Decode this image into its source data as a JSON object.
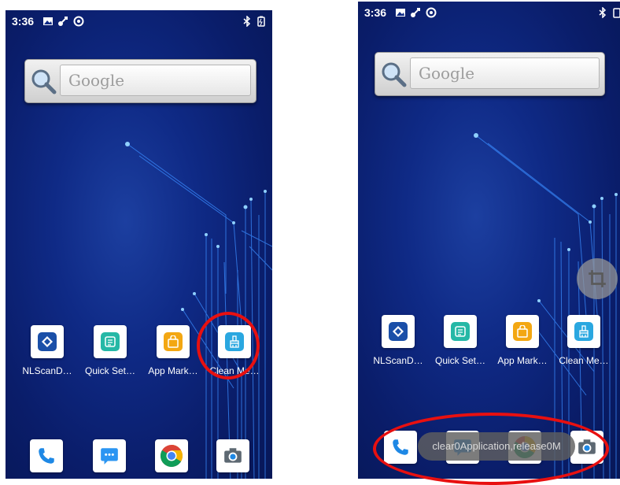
{
  "left_screen": {
    "status": {
      "time": "3:36"
    },
    "search": {
      "placeholder": "Google"
    },
    "apps": [
      {
        "label": "NLScanD…",
        "icon": "nlscan-icon"
      },
      {
        "label": "Quick Set…",
        "icon": "quick-settings-icon"
      },
      {
        "label": "App Mark…",
        "icon": "app-market-icon"
      },
      {
        "label": "Clean Me…",
        "icon": "clean-memory-icon"
      }
    ],
    "dock": [
      "phone-icon",
      "messages-icon",
      "chrome-icon",
      "camera-icon"
    ]
  },
  "right_screen": {
    "status": {
      "time": "3:36"
    },
    "search": {
      "placeholder": "Google"
    },
    "apps": [
      {
        "label": "NLScanD…",
        "icon": "nlscan-icon"
      },
      {
        "label": "Quick Set…",
        "icon": "quick-settings-icon"
      },
      {
        "label": "App Mark…",
        "icon": "app-market-icon"
      },
      {
        "label": "Clean Me…",
        "icon": "clean-memory-icon"
      }
    ],
    "dock": [
      "phone-icon",
      "messages-icon",
      "chrome-icon",
      "camera-icon"
    ],
    "toast": "clear0Application,release0M"
  },
  "colors": {
    "annotation": "#e81010",
    "quick_settings": "#25b8a6",
    "app_market": "#f3a712",
    "clean_memory": "#2aa7e0",
    "nlscan": "#1a4fa8",
    "phone": "#1e88e5"
  }
}
